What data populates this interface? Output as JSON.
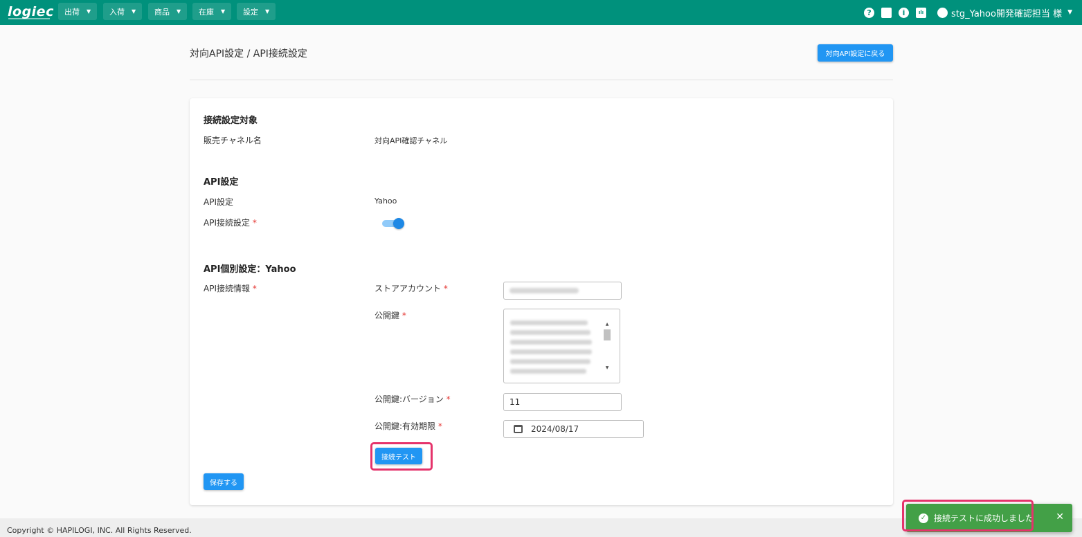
{
  "nav": {
    "logo": "logiec",
    "menus": [
      "出荷",
      "入荷",
      "商品",
      "在庫",
      "設定"
    ],
    "icons": [
      "help-icon",
      "briefcase-icon",
      "info-icon",
      "chart-icon",
      "account-icon"
    ],
    "help_glyph": "?",
    "info_glyph": "i",
    "chart_glyph": "ılı",
    "user": "stg_Yahoo開発確認担当 様"
  },
  "header": {
    "title": "対向API設定 / API接続設定",
    "back_label": "対向API設定に戻る"
  },
  "section1": {
    "heading": "接続設定対象",
    "channel_label": "販売チャネル名",
    "channel_value": "対向API確認チャネル"
  },
  "section2": {
    "heading": "API設定",
    "api_label": "API設定",
    "api_value": "Yahoo",
    "connect_label": "API接続設定",
    "connect_enabled": true
  },
  "section3": {
    "heading": "API個別設定：Yahoo",
    "info_label": "API接続情報",
    "store_account_label": "ストアアカウント",
    "public_key_label": "公開鍵",
    "key_version_label": "公開鍵:バージョン",
    "key_version_value": "11",
    "key_expiry_label": "公開鍵:有効期限",
    "key_expiry_value": "2024/08/17",
    "test_button": "接続テスト"
  },
  "required_mark": "*",
  "save_button": "保存する",
  "footer": "Copyright © HAPILOGI, INC. All Rights Reserved.",
  "snackbar": {
    "message": "接続テストに成功しました",
    "close": "✕",
    "check": "✓"
  },
  "colors": {
    "topbar": "#00917c",
    "primary": "#2196f3",
    "success": "#43a047",
    "highlight": "#e5336b"
  }
}
